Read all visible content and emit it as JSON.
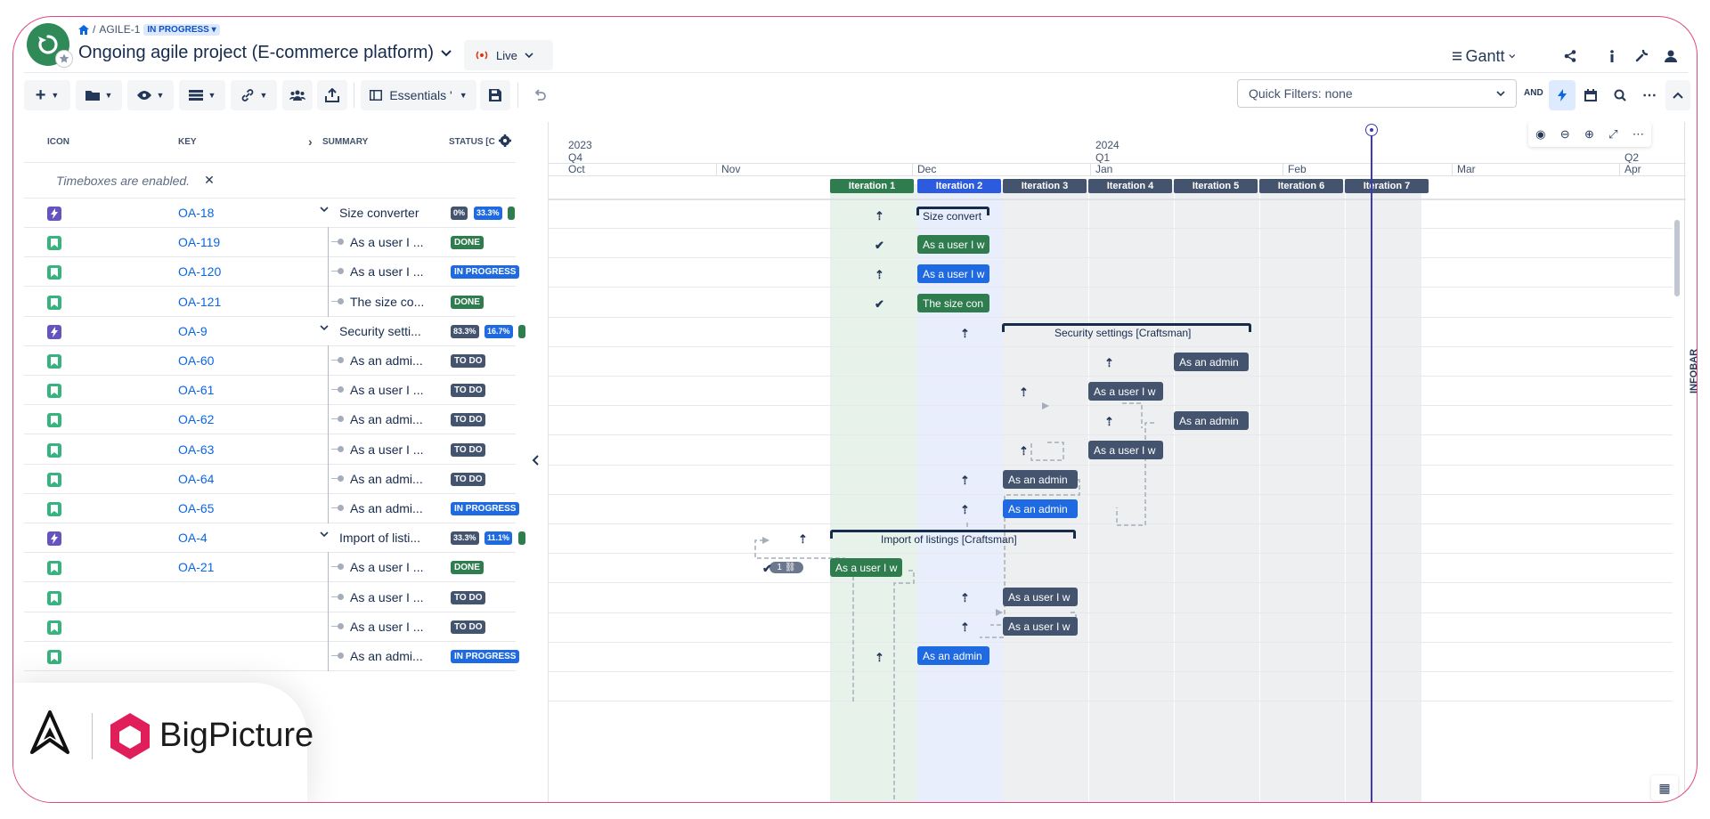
{
  "header": {
    "breadcrumb_project": "AGILE-1",
    "breadcrumb_status": "IN PROGRESS",
    "title": "Ongoing agile project (E-commerce platform)",
    "live_label": "Live",
    "view_label": "Gantt"
  },
  "toolbar": {
    "view_preset": "Essentials '",
    "quick_filters": "Quick Filters: none",
    "and_label": "AND"
  },
  "table": {
    "columns": [
      "ICON",
      "KEY",
      "SUMMARY",
      "STATUS [C"
    ],
    "timebox_notice": "Timeboxes are enabled.",
    "rows": [
      {
        "key": "OA-18",
        "summary": "Size converter",
        "type": "epic",
        "status": "",
        "pct": [
          "0%",
          "33.3%"
        ]
      },
      {
        "key": "OA-119",
        "summary": "As a user I ...",
        "type": "story",
        "status": "DONE"
      },
      {
        "key": "OA-120",
        "summary": "As a user I ...",
        "type": "story",
        "status": "IN PROGRESS"
      },
      {
        "key": "OA-121",
        "summary": "The size co...",
        "type": "story",
        "status": "DONE"
      },
      {
        "key": "OA-9",
        "summary": "Security setti...",
        "type": "epic",
        "status": "",
        "pct": [
          "83.3%",
          "16.7%"
        ]
      },
      {
        "key": "OA-60",
        "summary": "As an admi...",
        "type": "story",
        "status": "TO DO"
      },
      {
        "key": "OA-61",
        "summary": "As a user I ...",
        "type": "story",
        "status": "TO DO"
      },
      {
        "key": "OA-62",
        "summary": "As an admi...",
        "type": "story",
        "status": "TO DO"
      },
      {
        "key": "OA-63",
        "summary": "As a user I ...",
        "type": "story",
        "status": "TO DO"
      },
      {
        "key": "OA-64",
        "summary": "As an admi...",
        "type": "story",
        "status": "TO DO"
      },
      {
        "key": "OA-65",
        "summary": "As an admi...",
        "type": "story",
        "status": "IN PROGRESS"
      },
      {
        "key": "OA-4",
        "summary": "Import of listi...",
        "type": "epic",
        "status": "",
        "pct": [
          "33.3%",
          "11.1%"
        ]
      },
      {
        "key": "OA-21",
        "summary": "As a user I ...",
        "type": "story",
        "status": "DONE"
      },
      {
        "key": "",
        "summary": "As a user I ...",
        "type": "story",
        "status": "TO DO"
      },
      {
        "key": "",
        "summary": "As a user I ...",
        "type": "story",
        "status": "TO DO"
      },
      {
        "key": "",
        "summary": "As an admi...",
        "type": "story",
        "status": "IN PROGRESS"
      }
    ]
  },
  "timeline": {
    "year1": "2023",
    "year2": "2024",
    "q4": "Q4",
    "q1": "Q1",
    "q2": "Q2",
    "months": [
      "Oct",
      "Nov",
      "Dec",
      "Jan",
      "Feb",
      "Mar",
      "Apr"
    ],
    "iterations": [
      "Iteration 1",
      "Iteration 2",
      "Iteration 3",
      "Iteration 4",
      "Iteration 5",
      "Iteration 6",
      "Iteration 7"
    ],
    "bars": {
      "size_converter": "Size convert",
      "u1": "As a user I w",
      "u2": "As a user I w",
      "u3": "The size con",
      "security": "Security settings [Craftsman]",
      "a1": "As an admin",
      "a2": "As a user I w",
      "a3": "As an admin",
      "a4": "As a user I w",
      "a5": "As an admin",
      "a6": "As an admin",
      "import": "Import of listings [Craftsman]",
      "i1": "As a user I w",
      "i1_badge": "1",
      "i2": "As a user I w",
      "i3": "As a user I w",
      "i4": "As an admin"
    },
    "infobar": "INFOBAR"
  },
  "brand": {
    "name": "BigPicture"
  },
  "colors": {
    "done": "#2f7d4f",
    "inprogress": "#1f6ae0",
    "todo": "#44546f",
    "epic": "#6554c0",
    "story": "#36b37e"
  }
}
